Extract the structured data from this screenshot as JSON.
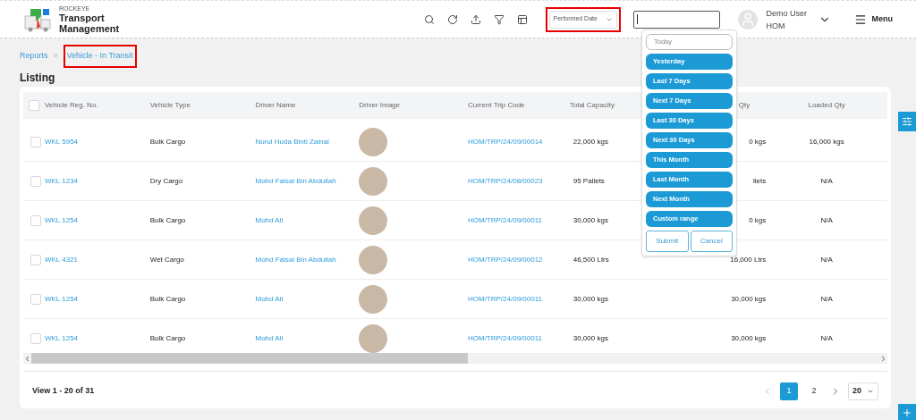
{
  "brand": {
    "tagline": "ROCKEYE",
    "name_line1": "Transport",
    "name_line2": "Management"
  },
  "toolbar": {
    "date_filter": {
      "value": "Performed Date"
    }
  },
  "user": {
    "name": "Demo User",
    "org": "HOM"
  },
  "menu_label": "Menu",
  "breadcrumb_separator": "»",
  "breadcrumb": [
    {
      "label": "Reports",
      "selected": false
    },
    {
      "label": "Vehicle - In Transit",
      "selected": true
    }
  ],
  "page_title": "Listing",
  "table": {
    "select_all_checked": false,
    "columns": [
      "Vehicle Reg. No.",
      "Vehicle Type",
      "Driver Name",
      "Driver Image",
      "Current Trip Code",
      "Total Capacity",
      "Qty",
      "Loaded Qty"
    ],
    "rows": [
      {
        "checked": false,
        "reg": "WKL 5954",
        "type": "Bulk Cargo",
        "driver": "Nurul Huda Binti Zainal",
        "trip": "HOM/TRP/24/09/00014",
        "capacity": "22,000 kgs",
        "column_7": "0 kgs",
        "loaded": "16,000 kgs"
      },
      {
        "checked": false,
        "reg": "WKL 1234",
        "type": "Dry Cargo",
        "driver": "Mohd Faisal Bin Abdullah",
        "trip": "HOM/TRP/24/08/00023",
        "capacity": "95 Pallets",
        "column_7": "llets",
        "loaded": "N/A"
      },
      {
        "checked": false,
        "reg": "WKL 1254",
        "type": "Bulk Cargo",
        "driver": "Mohd Ali",
        "trip": "HOM/TRP/24/09/00011",
        "capacity": "30,000 kgs",
        "column_7": "0 kgs",
        "loaded": "N/A"
      },
      {
        "checked": false,
        "reg": "WKL 4321",
        "type": "Wet Cargo",
        "driver": "Mohd Faisal Bin Abdullah",
        "trip": "HOM/TRP/24/09/00012",
        "capacity": "46,500 Ltrs",
        "column_7": "16,000 Ltrs",
        "loaded": "N/A"
      },
      {
        "checked": false,
        "reg": "WKL 1254",
        "type": "Bulk Cargo",
        "driver": "Mohd Ali",
        "trip": "HOM/TRP/24/09/00011",
        "capacity": "30,000 kgs",
        "column_7": "30,000 kgs",
        "loaded": "N/A"
      },
      {
        "checked": false,
        "reg": "WKL 1254",
        "type": "Bulk Cargo",
        "driver": "Mohd Ali",
        "trip": "HOM/TRP/24/09/00011",
        "capacity": "30,000 kgs",
        "column_7": "30,000 kgs",
        "loaded": "N/A"
      }
    ]
  },
  "view_summary": "View 1 - 20 of 31",
  "pagination": {
    "pages": [
      {
        "label": "1",
        "selected": true
      },
      {
        "label": "2",
        "selected": false
      }
    ],
    "page_size": "20"
  },
  "date_ranges": {
    "options": [
      {
        "label": "Today",
        "highlighted": false
      },
      {
        "label": "Yesterday",
        "highlighted": true
      },
      {
        "label": "Last 7 Days",
        "highlighted": true
      },
      {
        "label": "Next 7 Days",
        "highlighted": true
      },
      {
        "label": "Last 30 Days",
        "highlighted": true
      },
      {
        "label": "Next 30 Days",
        "highlighted": true
      },
      {
        "label": "This Month",
        "highlighted": true
      },
      {
        "label": "Last Month",
        "highlighted": true
      },
      {
        "label": "Next Month",
        "highlighted": true
      },
      {
        "label": "Custom range",
        "highlighted": true
      }
    ],
    "buttons": [
      "Submit",
      "Cancel"
    ]
  }
}
